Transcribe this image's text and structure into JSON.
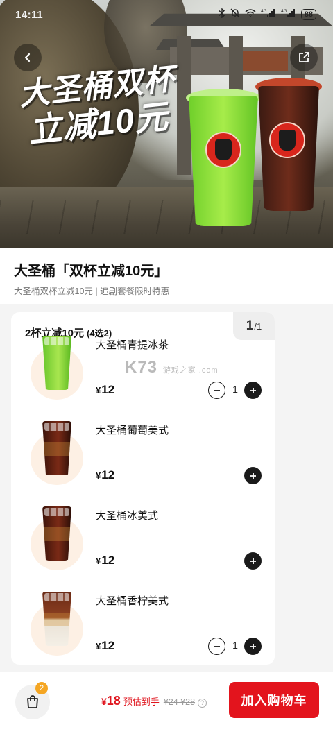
{
  "status_bar": {
    "time": "14:11",
    "battery": "88",
    "signal_labels": [
      "4G",
      "4G"
    ]
  },
  "hero": {
    "promo_line1": "大圣桶双杯",
    "promo_line2": "立减10元",
    "back_icon": "chevron-left-icon",
    "share_icon": "share-external-icon"
  },
  "product": {
    "title": "大圣桶「双杯立减10元」",
    "subtitle": "大圣桶双杯立减10元 | 追剧套餐限时特惠"
  },
  "group": {
    "title": "2杯立减10元",
    "hint": "(4选2)",
    "page_current": "1",
    "page_total": "/1",
    "items": [
      {
        "name": "大圣桶青提冰茶",
        "currency": "¥",
        "price": "12",
        "quantity": "1",
        "cup_style": "green"
      },
      {
        "name": "大圣桶葡萄美式",
        "currency": "¥",
        "price": "12",
        "quantity": "",
        "cup_style": "dark"
      },
      {
        "name": "大圣桶冰美式",
        "currency": "¥",
        "price": "12",
        "quantity": "",
        "cup_style": "dark"
      },
      {
        "name": "大圣桶香柠美式",
        "currency": "¥",
        "price": "12",
        "quantity": "1",
        "cup_style": "latte"
      }
    ]
  },
  "watermark": {
    "text": "K73",
    "sub": "游戏之家 .com"
  },
  "bottom_bar": {
    "cart_badge": "2",
    "currency": "¥",
    "total": "18",
    "total_label": "预估到手",
    "original": "¥24 ¥28",
    "info_mark": "?",
    "add_to_cart": "加入购物车"
  },
  "colors": {
    "accent": "#e3141d",
    "badge": "#f5a623",
    "text": "#111111"
  }
}
